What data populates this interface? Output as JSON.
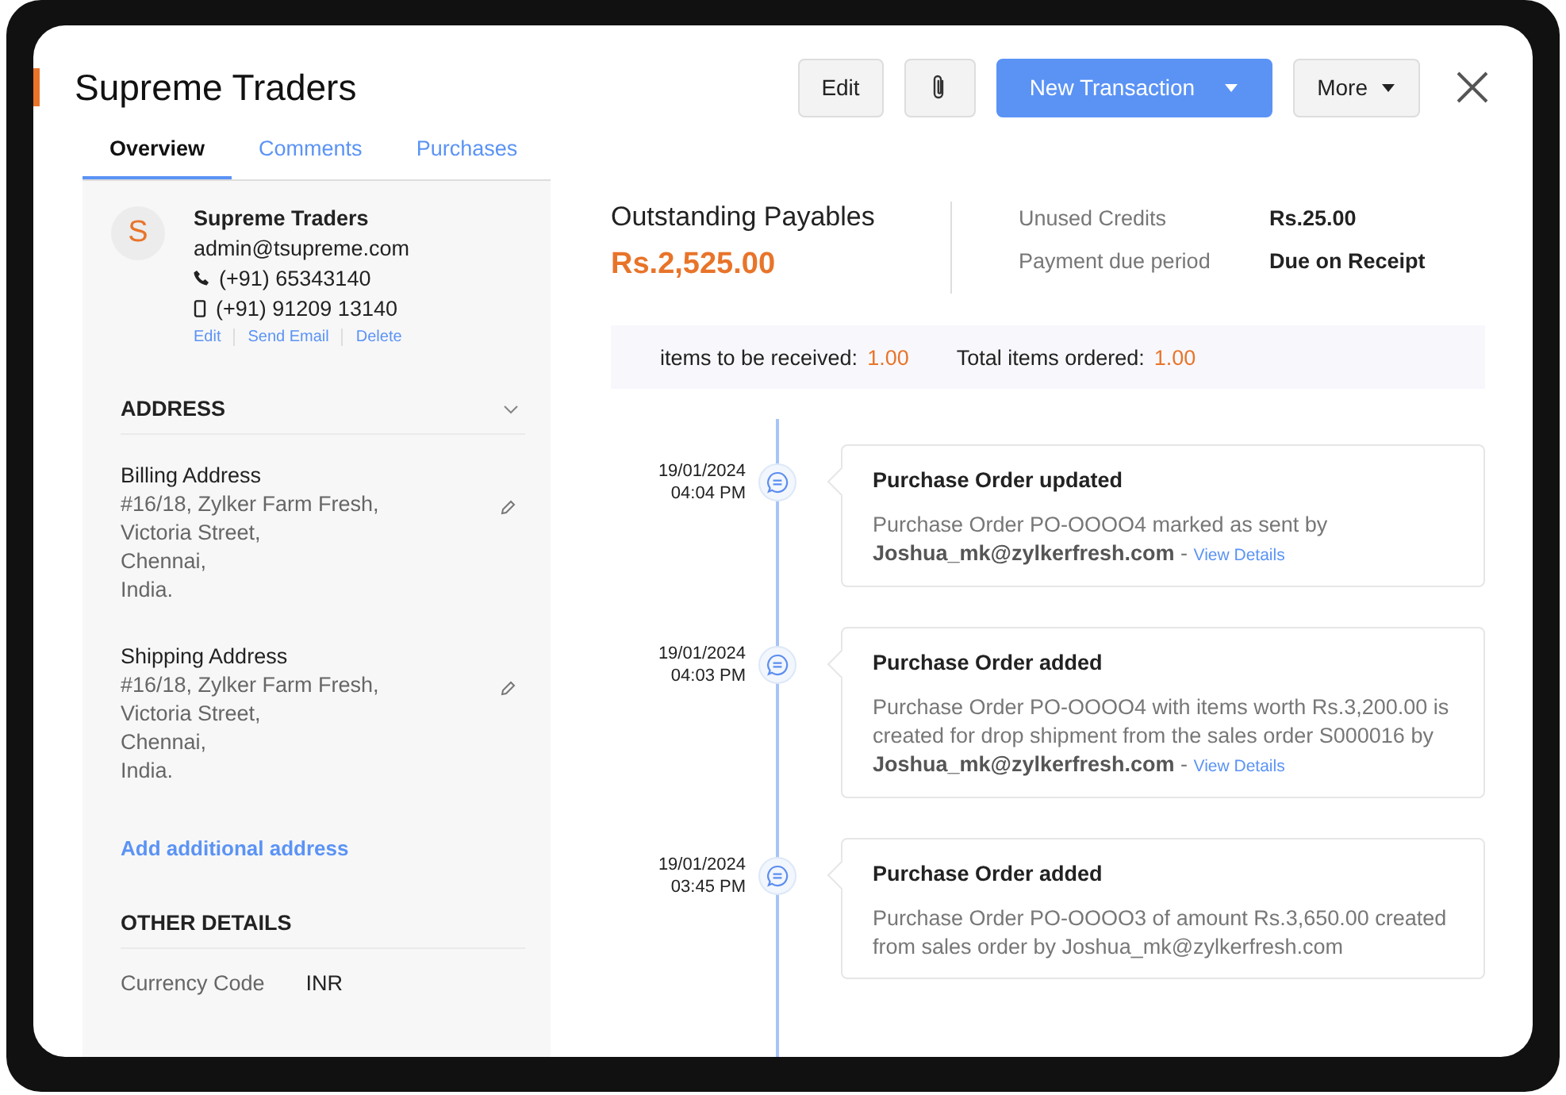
{
  "header": {
    "title": "Supreme Traders",
    "buttons": [
      {
        "kind": "text",
        "label": "Edit"
      },
      {
        "kind": "icon"
      },
      {
        "kind": "primary",
        "label": "New Transaction"
      },
      {
        "kind": "menu",
        "label": "More"
      }
    ]
  },
  "tabs": [
    {
      "label": "Overview",
      "selected": true
    },
    {
      "label": "Comments",
      "selected": false
    },
    {
      "label": "Purchases",
      "selected": false
    }
  ],
  "contact": {
    "initial": "S",
    "name": "Supreme Traders",
    "email": "admin@tsupreme.com",
    "phone": "(+91) 65343140",
    "mobile": "(+91) 91209 13140",
    "actions": [
      "Edit",
      "Send Email",
      "Delete"
    ]
  },
  "address": {
    "heading": "ADDRESS",
    "expanded": true,
    "blocks": [
      {
        "title": "Billing Address",
        "lines": [
          "#16/18, Zylker Farm Fresh,",
          "Victoria Street,",
          "Chennai,",
          "India."
        ]
      },
      {
        "title": "Shipping Address",
        "lines": [
          "#16/18, Zylker Farm Fresh,",
          "Victoria Street,",
          "Chennai,",
          "India."
        ]
      }
    ],
    "add_link": "Add additional address"
  },
  "other_details": {
    "heading": "OTHER DETAILS",
    "rows": [
      {
        "label": "Currency Code",
        "value": "INR"
      }
    ]
  },
  "summary": {
    "label": "Outstanding Payables",
    "amount": "Rs.2,525.00",
    "details": [
      {
        "label": "Unused Credits",
        "value": "Rs.25.00"
      },
      {
        "label": "Payment due period",
        "value": "Due on Receipt"
      }
    ]
  },
  "stats": [
    {
      "label": "items to be received:",
      "value": "1.00"
    },
    {
      "label": "Total items ordered:",
      "value": "1.00"
    }
  ],
  "timeline": [
    {
      "date": "19/01/2024",
      "time": "04:04 PM",
      "title": "Purchase Order updated",
      "text": "Purchase Order PO-OOOO4 marked as sent by **Joshua_mk@zylkerfresh.com** -",
      "link": "View Details"
    },
    {
      "date": "19/01/2024",
      "time": "04:03 PM",
      "title": "Purchase Order added",
      "text": "Purchase Order PO-OOOO4 with items worth Rs.3,200.00 is created for drop shipment from the sales order S000016 by **Joshua_mk@zylkerfresh.com** -",
      "link": "View Details"
    },
    {
      "date": "19/01/2024",
      "time": "03:45 PM",
      "title": "Purchase Order added",
      "text": "Purchase Order PO-OOOO3 of amount Rs.3,650.00 created from sales order by Joshua_mk@zylkerfresh.com"
    }
  ]
}
